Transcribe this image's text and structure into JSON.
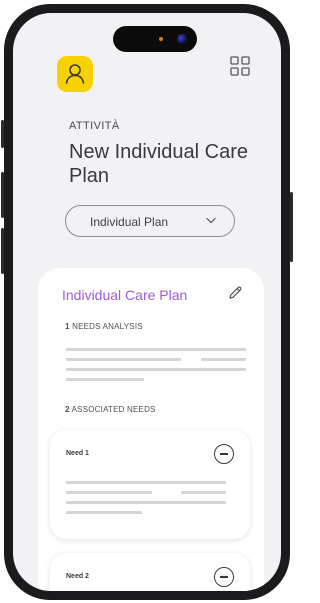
{
  "header": {
    "category": "ATTIVITÀ",
    "title": "New Individual Care Plan"
  },
  "plan_select": {
    "selected": "Individual Plan"
  },
  "care_plan_card": {
    "title": "Individual Care Plan",
    "sections": [
      {
        "number": "1",
        "label": "NEEDS ANALYSIS"
      },
      {
        "number": "2",
        "label": "ASSOCIATED NEEDS"
      }
    ],
    "needs": [
      {
        "label": "Need 1"
      },
      {
        "label": "Need 2"
      }
    ]
  },
  "colors": {
    "accent": "#f7d200",
    "title_purple": "#a05ad6",
    "frame": "#1b1b1d"
  },
  "icons": {
    "avatar": "user-icon",
    "menu": "grid-icon",
    "edit": "pencil-icon",
    "remove": "minus-circle-icon",
    "dropdown": "chevron-down-icon"
  }
}
